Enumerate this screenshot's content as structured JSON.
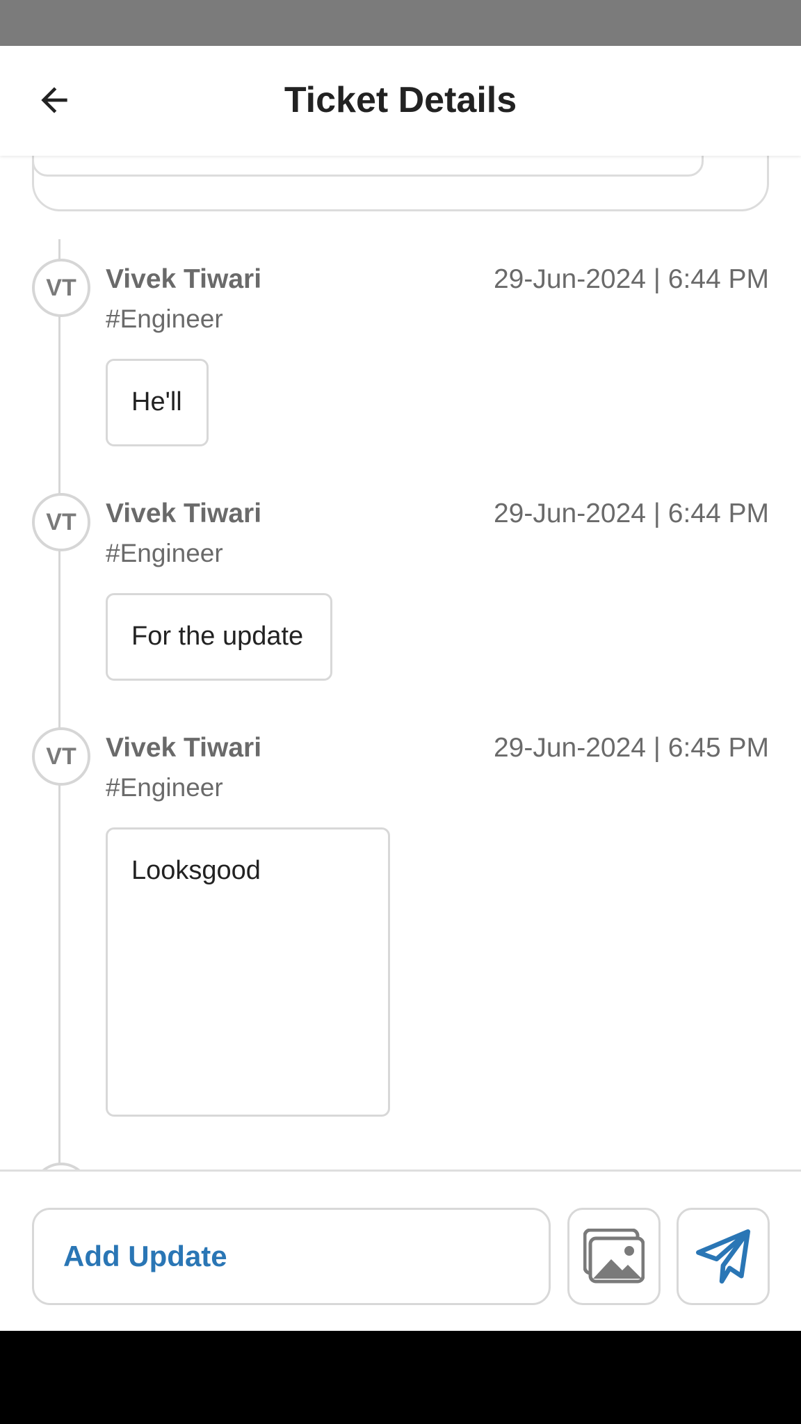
{
  "header": {
    "title": "Ticket Details"
  },
  "updates": [
    {
      "initials": "VT",
      "author": "Vivek Tiwari",
      "role": "#Engineer",
      "timestamp": "29-Jun-2024 | 6:44 PM",
      "message": "He'll"
    },
    {
      "initials": "VT",
      "author": "Vivek Tiwari",
      "role": "#Engineer",
      "timestamp": "29-Jun-2024 | 6:44 PM",
      "message": "For the update"
    },
    {
      "initials": "VT",
      "author": "Vivek Tiwari",
      "role": "#Engineer",
      "timestamp": "29-Jun-2024 | 6:45 PM",
      "message": "Looksgood"
    }
  ],
  "composer": {
    "add_update_label": "Add Update",
    "gallery_icon": "image-gallery-icon",
    "send_icon": "send-icon"
  },
  "colors": {
    "accent": "#2a76b5",
    "muted_text": "#6a6a6a",
    "border": "#d8d8d8"
  }
}
